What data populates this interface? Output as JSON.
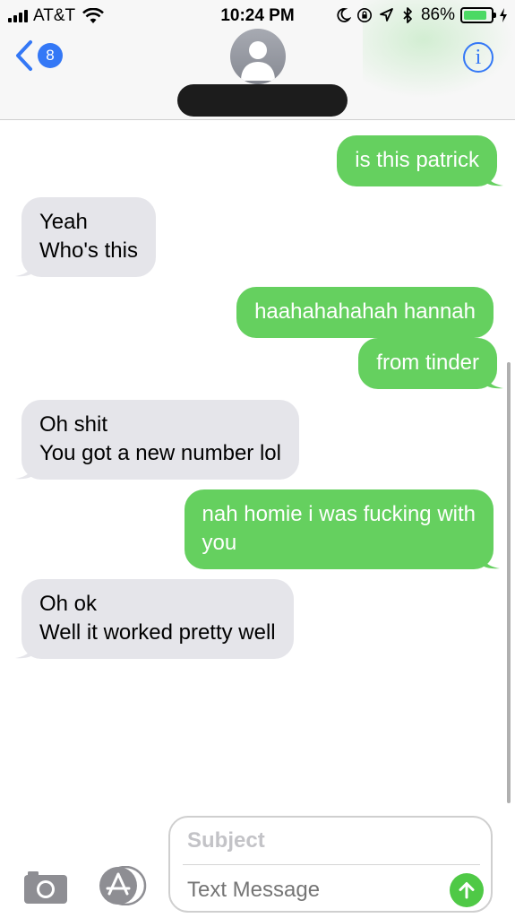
{
  "status_bar": {
    "carrier": "AT&T",
    "time": "10:24 PM",
    "battery_percent": "86%",
    "battery_level": 0.86,
    "icons": [
      "signal-icon",
      "wifi-icon",
      "moon-icon",
      "orientation-lock-icon",
      "location-icon",
      "bluetooth-icon",
      "battery-icon",
      "charging-icon"
    ]
  },
  "header": {
    "back_badge": "8",
    "info_label": "i"
  },
  "messages": [
    {
      "direction": "out",
      "lines": [
        "is this patrick"
      ]
    },
    {
      "direction": "in",
      "lines": [
        "Yeah",
        "Who's this"
      ]
    },
    {
      "direction": "out",
      "lines": [
        "haahahahahah hannah"
      ]
    },
    {
      "direction": "out",
      "lines": [
        "from tinder"
      ]
    },
    {
      "direction": "in",
      "lines": [
        "Oh shit",
        "You got a new number lol"
      ]
    },
    {
      "direction": "out",
      "lines": [
        "nah homie i was fucking with",
        "you"
      ]
    },
    {
      "direction": "in",
      "lines": [
        "Oh ok",
        "Well it worked pretty well"
      ]
    }
  ],
  "composer": {
    "subject_placeholder": "Subject",
    "text_placeholder": "Text Message"
  },
  "colors": {
    "outgoing_bubble": "#65d05f",
    "incoming_bubble": "#e5e5ea",
    "accent_blue": "#3478f6",
    "send_green": "#4fc946"
  }
}
